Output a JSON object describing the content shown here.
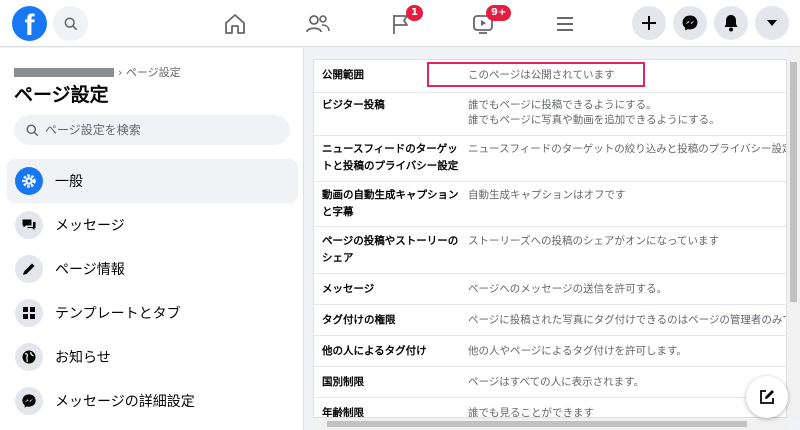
{
  "topbar": {
    "logo": "f",
    "search_icon": "search-icon",
    "nav": [
      {
        "name": "home",
        "icon": "home-icon",
        "badge": ""
      },
      {
        "name": "friends",
        "icon": "friends-icon",
        "badge": ""
      },
      {
        "name": "pages",
        "icon": "flag-icon",
        "badge": "1"
      },
      {
        "name": "watch",
        "icon": "video-icon",
        "badge": "9+"
      },
      {
        "name": "menu",
        "icon": "menu-icon",
        "badge": ""
      }
    ],
    "right_buttons": [
      "plus-icon",
      "messenger-icon",
      "bell-icon",
      "caret-down-icon"
    ]
  },
  "sidebar": {
    "breadcrumb": "› ページ設定",
    "title": "ページ設定",
    "search_placeholder": "ページ設定を検索",
    "items": [
      {
        "label": "一般",
        "icon": "gear-icon",
        "active": true
      },
      {
        "label": "メッセージ",
        "icon": "chat-icon",
        "active": false
      },
      {
        "label": "ページ情報",
        "icon": "pencil-icon",
        "active": false
      },
      {
        "label": "テンプレートとタブ",
        "icon": "grid-icon",
        "active": false
      },
      {
        "label": "お知らせ",
        "icon": "globe-icon",
        "active": false
      },
      {
        "label": "メッセージの詳細設定",
        "icon": "messenger-icon",
        "active": false
      }
    ]
  },
  "settings": {
    "rows": [
      {
        "label": "公開範囲",
        "value": "このページは公開されています",
        "value2": ""
      },
      {
        "label": "ビジター投稿",
        "value": "誰でもページに投稿できるようにする。",
        "value2": "誰でもページに写真や動画を追加できるようにする。"
      },
      {
        "label": "ニュースフィードのターゲットと投稿のプライバシー設定",
        "value": "ニュースフィードのターゲットの絞り込みと投稿のプライバシー設定に",
        "value2": ""
      },
      {
        "label": "動画の自動生成キャプションと字幕",
        "value": "自動生成キャプションはオフです",
        "value2": ""
      },
      {
        "label": "ページの投稿やストーリーのシェア",
        "value": "ストーリーズへの投稿のシェアがオンになっています",
        "value2": ""
      },
      {
        "label": "メッセージ",
        "value": "ページへのメッセージの送信を許可する。",
        "value2": ""
      },
      {
        "label": "タグ付けの権限",
        "value": "ページに投稿された写真にタグ付けできるのはページの管理者のみで",
        "value2": ""
      },
      {
        "label": "他の人によるタグ付け",
        "value": "他の人やページによるタグ付けを許可します。",
        "value2": ""
      },
      {
        "label": "国別制限",
        "value": "ページはすべての人に表示されます。",
        "value2": ""
      },
      {
        "label": "年齢制限",
        "value": "誰でも見ることができます",
        "value2": ""
      }
    ]
  },
  "colors": {
    "brand": "#1877f2",
    "badge": "#e41e3f",
    "highlight": "#e0245e"
  }
}
